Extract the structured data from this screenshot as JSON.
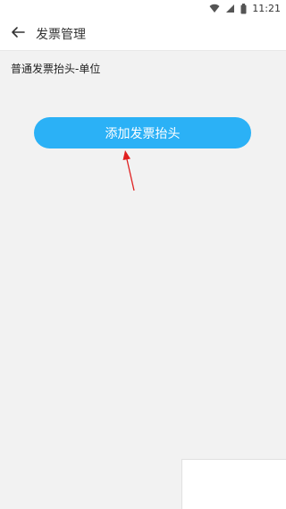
{
  "status_bar": {
    "time": "11:21",
    "icons": [
      "wifi-icon",
      "signal-icon",
      "battery-icon"
    ]
  },
  "app_bar": {
    "title": "发票管理",
    "back_icon": "arrow-left-icon"
  },
  "section": {
    "title": "普通发票抬头-单位"
  },
  "actions": {
    "add_label": "添加发票抬头"
  },
  "colors": {
    "accent": "#2bb1f6",
    "background": "#f2f2f2",
    "annotation_arrow": "#e02020"
  }
}
